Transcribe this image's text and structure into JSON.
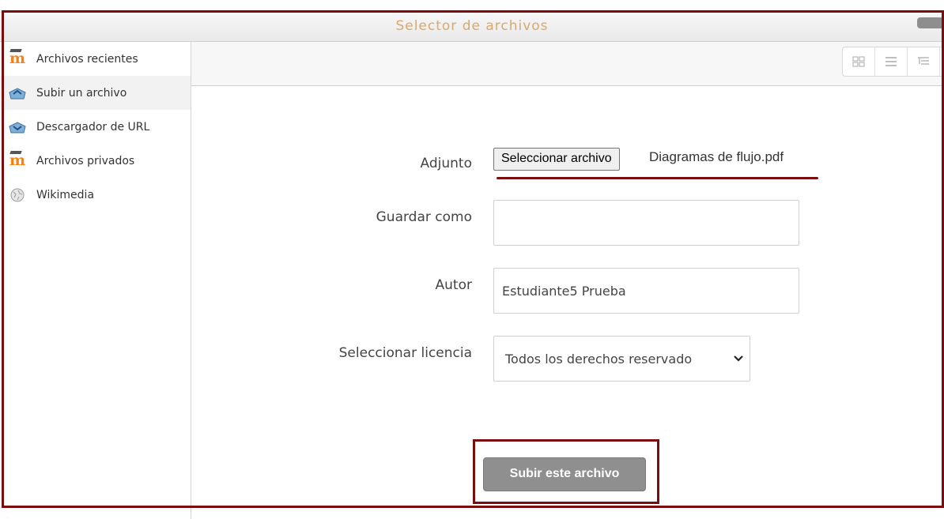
{
  "dialog": {
    "title": "Selector de archivos"
  },
  "sidebar": {
    "items": [
      {
        "label": "Archivos recientes",
        "icon": "moodle-icon"
      },
      {
        "label": "Subir un archivo",
        "icon": "upload-icon"
      },
      {
        "label": "Descargador de URL",
        "icon": "download-url-icon"
      },
      {
        "label": "Archivos privados",
        "icon": "moodle-icon"
      },
      {
        "label": "Wikimedia",
        "icon": "wikimedia-icon"
      }
    ]
  },
  "toolbar": {
    "views": [
      "grid-view-icon",
      "list-view-icon",
      "tree-view-icon"
    ]
  },
  "form": {
    "attachment_label": "Adjunto",
    "choose_file_button": "Seleccionar archivo",
    "chosen_file": "Diagramas de flujo.pdf",
    "save_as_label": "Guardar como",
    "save_as_value": "",
    "author_label": "Autor",
    "author_value": "Estudiante5 Prueba",
    "license_label": "Seleccionar licencia",
    "license_value": "Todos los derechos reservado",
    "upload_button": "Subir este archivo"
  },
  "colors": {
    "highlight": "#7a0e0e",
    "title": "#d9a86e",
    "moodle_orange": "#f98012"
  }
}
